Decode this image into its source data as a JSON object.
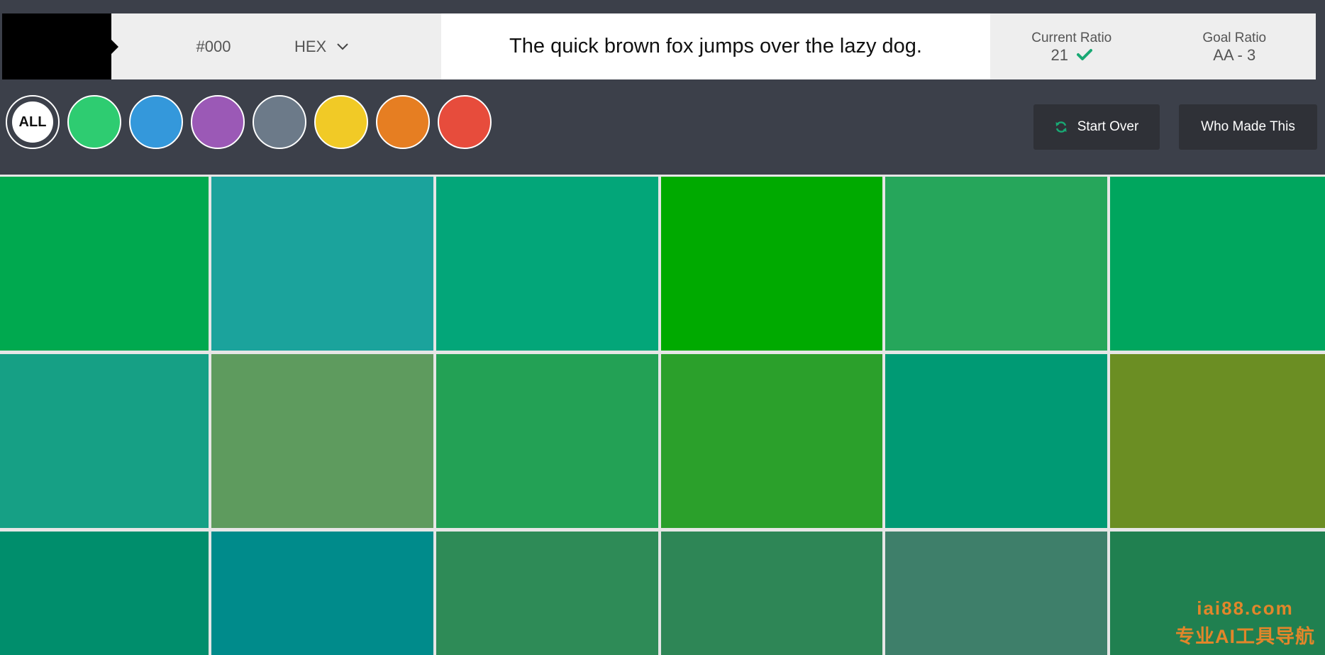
{
  "selected_color": {
    "swatch": "#000000",
    "value": "#000",
    "format": "HEX"
  },
  "sample_text": "The quick brown fox jumps over the lazy dog.",
  "current_ratio": {
    "label": "Current Ratio",
    "value": "21",
    "pass": true,
    "pass_color": "#19a974"
  },
  "goal_ratio": {
    "label": "Goal Ratio",
    "value": "AA - 3"
  },
  "filters": [
    {
      "label": "ALL",
      "color": "#ffffff"
    },
    {
      "name": "green",
      "color": "#2ecc71"
    },
    {
      "name": "blue",
      "color": "#3498db"
    },
    {
      "name": "purple",
      "color": "#9b59b6"
    },
    {
      "name": "gray",
      "color": "#6c7a89"
    },
    {
      "name": "yellow",
      "color": "#f1ca26"
    },
    {
      "name": "orange",
      "color": "#e67e22"
    },
    {
      "name": "red",
      "color": "#e74c3c"
    }
  ],
  "buttons": {
    "start_over": "Start Over",
    "who_made_this": "Who Made This"
  },
  "icons": {
    "format_select": "chevron-down-icon",
    "ratio_pass": "check-icon",
    "start_over": "refresh-icon"
  },
  "swatches": [
    [
      "#00a94f",
      "#1ba39c",
      "#03a679",
      "#00aa00",
      "#26a65b",
      "#00a65e"
    ],
    [
      "#16a085",
      "#5e9b5e",
      "#23a155",
      "#2ba02b",
      "#009a74",
      "#6b8e23"
    ],
    [
      "#008e6c",
      "#008b8b",
      "#2e8b57",
      "#2e8656",
      "#3e7f6a",
      "#208050"
    ]
  ],
  "watermark": {
    "line1": "iai88.com",
    "line2": "专业AI工具导航"
  }
}
